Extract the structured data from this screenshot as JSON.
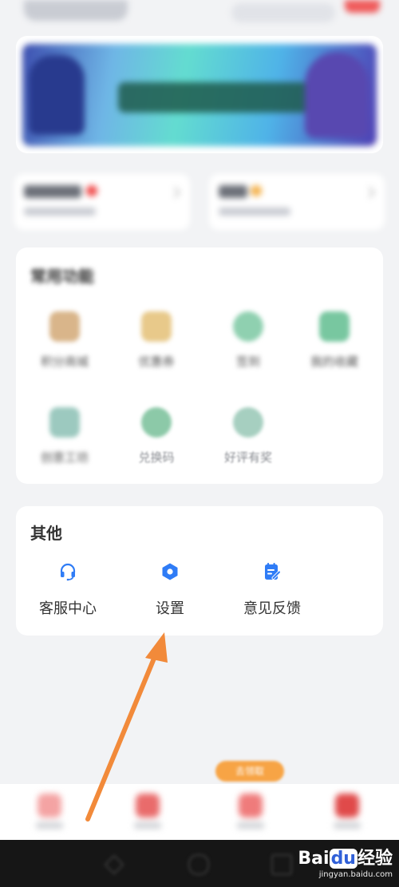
{
  "common": {
    "title": "常用功能",
    "items": [
      {
        "label": "积分商城",
        "icon": "coins-icon",
        "color": "#d9b58a"
      },
      {
        "label": "优惠券",
        "icon": "coupon-icon",
        "color": "#e8c98a"
      },
      {
        "label": "签到",
        "icon": "checkin-icon",
        "color": "#8fd0b0"
      },
      {
        "label": "我的收藏",
        "icon": "collection-icon",
        "color": "#78c7a0"
      },
      {
        "label": "创意工坊",
        "icon": "workshop-icon",
        "color": "#9cc9bf"
      },
      {
        "label": "兑换码",
        "icon": "redeem-code-icon",
        "color": "#8cc9a8"
      },
      {
        "label": "好评有奖",
        "icon": "review-reward-icon",
        "color": "#a6cfc0"
      }
    ]
  },
  "other": {
    "title": "其他",
    "items": [
      {
        "label": "客服中心",
        "icon": "headset-icon"
      },
      {
        "label": "设置",
        "icon": "gear-icon"
      },
      {
        "label": "意见反馈",
        "icon": "feedback-icon"
      }
    ],
    "accent_color": "#2f7cf6"
  },
  "bottom_tabs": [
    {
      "label": "首页",
      "icon": "home-icon"
    },
    {
      "label": "分类",
      "icon": "category-icon"
    },
    {
      "label": "消息",
      "icon": "message-icon"
    },
    {
      "label": "我的",
      "icon": "profile-icon"
    }
  ],
  "center_pill": "去领取",
  "watermark": {
    "brand": "Bai",
    "brand_paw": "du",
    "suffix": "经验",
    "url": "jingyan.baidu.com"
  },
  "colors": {
    "arrow": "#f28a3a",
    "background": "#f2f3f5",
    "card": "#ffffff"
  }
}
